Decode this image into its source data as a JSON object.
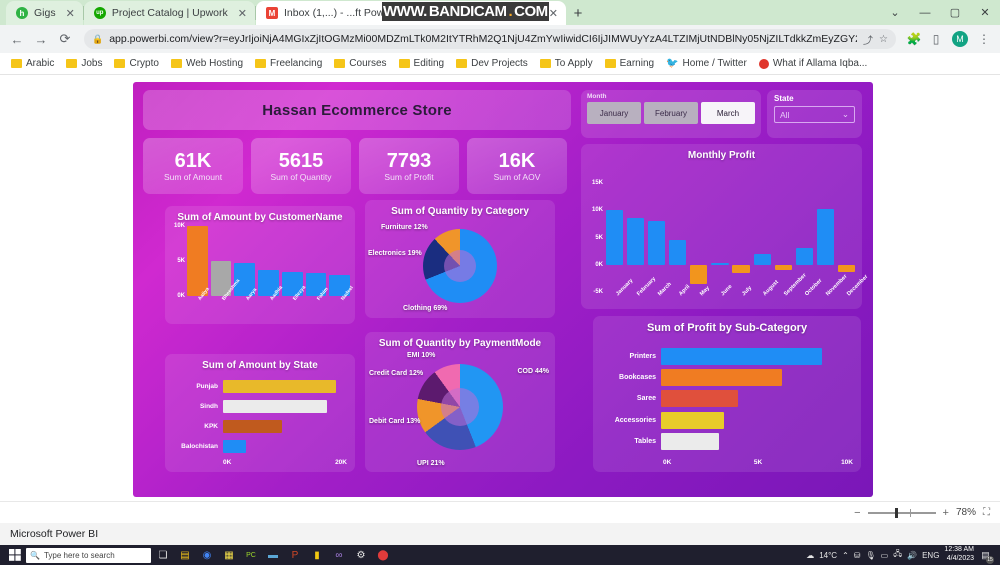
{
  "browser": {
    "tabs": [
      {
        "title": "Gigs",
        "favicon_letter": "h",
        "favicon_color": "#2fb344",
        "active": false
      },
      {
        "title": "Project Catalog | Upwork",
        "favicon_letter": "up",
        "favicon_color": "#14a800",
        "active": false
      },
      {
        "title": "Inbox (1,...) - ...ft Power BI",
        "favicon_letter": "M",
        "favicon_color": "#ea4335",
        "active": true
      }
    ],
    "newtab_label": "+",
    "window_controls": {
      "list": "⌄",
      "minimize": "—",
      "maximize": "▢",
      "close": "✕"
    },
    "nav": {
      "back": "←",
      "forward": "→",
      "reload": "⟳"
    },
    "omnibox": {
      "lock_icon": "lock-icon",
      "url": "app.powerbi.com/view?r=eyJrIjoiNjA4MGIxZjItOGMzMi00MDZmLTk0M2ItYTRhM2Q1NjU4ZmYwIiwidCI6IjJIMWUyYzA4LTZIMjUtNDBlNy05NjZILTdkkZmEyZGY2Y...",
      "share_icon": "share-icon",
      "star_icon": "bookmark-star-icon"
    },
    "toolbar_icons": {
      "extensions": "puzzle-icon",
      "sidepanel": "side-panel-icon",
      "profile": "M",
      "menu": "⋮"
    },
    "bookmarks": [
      {
        "label": "Arabic",
        "type": "folder"
      },
      {
        "label": "Jobs",
        "type": "folder"
      },
      {
        "label": "Crypto",
        "type": "folder"
      },
      {
        "label": "Web Hosting",
        "type": "folder"
      },
      {
        "label": "Freelancing",
        "type": "folder"
      },
      {
        "label": "Courses",
        "type": "folder"
      },
      {
        "label": "Editing",
        "type": "folder"
      },
      {
        "label": "Dev Projects",
        "type": "folder"
      },
      {
        "label": "To Apply",
        "type": "folder"
      },
      {
        "label": "Earning",
        "type": "folder"
      },
      {
        "label": "Home / Twitter",
        "type": "twitter"
      },
      {
        "label": "What if Allama Iqba...",
        "type": "site"
      }
    ]
  },
  "watermark": {
    "text_pre": "WWW.",
    "text_mid": "BANDICAM",
    "text_dot": ".",
    "text_post": "COM"
  },
  "report": {
    "header_title": "Hassan Ecommerce Store",
    "kpis": [
      {
        "value": "61K",
        "label": "Sum of Amount"
      },
      {
        "value": "5615",
        "label": "Sum of Quantity"
      },
      {
        "value": "7793",
        "label": "Sum of Profit"
      },
      {
        "value": "16K",
        "label": "Sum of AOV"
      }
    ],
    "month_slicer": {
      "label": "Month",
      "options": [
        "January",
        "February",
        "March"
      ],
      "selected": "March"
    },
    "state_filter": {
      "label": "State",
      "value": "All",
      "chevron": "chevron-down-icon"
    }
  },
  "zoom_bar": {
    "minus": "−",
    "plus": "+",
    "percent": "78%",
    "fit_icon": "fit-to-page-icon"
  },
  "status_strip": {
    "title": "Microsoft Power BI"
  },
  "taskbar": {
    "start_icon": "windows-start-icon",
    "search_placeholder": "Type here to search",
    "search_icon": "search-icon",
    "items": [
      {
        "name": "task-view-icon",
        "glyph": "❏"
      },
      {
        "name": "file-explorer-icon",
        "glyph": "▤"
      },
      {
        "name": "chrome-icon",
        "glyph": "◉"
      },
      {
        "name": "sticky-notes-icon",
        "glyph": "▦"
      },
      {
        "name": "pycharm-icon",
        "glyph": "PC"
      },
      {
        "name": "mysql-workbench-icon",
        "glyph": "▬"
      },
      {
        "name": "powerpoint-icon",
        "glyph": "P"
      },
      {
        "name": "power-bi-icon",
        "glyph": "▮"
      },
      {
        "name": "visual-studio-icon",
        "glyph": "∞"
      },
      {
        "name": "settings-icon",
        "glyph": "⚙"
      },
      {
        "name": "bandicam-record-icon",
        "glyph": "⬤"
      }
    ],
    "weather": {
      "icon": "cloud-icon",
      "temp": "14°C"
    },
    "tray": {
      "chevron": "⌃",
      "onedrive": "☁",
      "mic": "🎙",
      "battery": "▭",
      "network": "🖧",
      "volume": "🔊"
    },
    "language": "ENG",
    "clock": {
      "time": "12:38 AM",
      "date": "4/4/2023"
    },
    "notifications": {
      "icon": "notifications-icon",
      "count": "15"
    }
  },
  "chart_data": [
    {
      "type": "bar",
      "id": "monthly-profit",
      "title": "Monthly Profit",
      "categories": [
        "January",
        "February",
        "March",
        "April",
        "May",
        "June",
        "July",
        "August",
        "September",
        "October",
        "November",
        "December"
      ],
      "values": [
        10000,
        8600,
        8000,
        4500,
        -3500,
        300,
        -1500,
        2000,
        -1000,
        3000,
        10300,
        -1300
      ],
      "ylim": [
        -5000,
        15000
      ],
      "ytick_labels": [
        "15K",
        "10K",
        "5K",
        "0K",
        "-5K"
      ],
      "ytick_values": [
        15000,
        10000,
        5000,
        0,
        -5000
      ],
      "positive_color": "#1f8df5",
      "negative_color": "#f2951d",
      "xlabel": "",
      "ylabel": "",
      "grid": false,
      "legend": false
    },
    {
      "type": "bar",
      "id": "amount-by-customer",
      "title": "Sum of Amount by CustomerName",
      "categories": [
        "Aaliya",
        "Bheeshma",
        "Aarya",
        "Aadhia",
        "Ellezya",
        "Fahim",
        "Nadeel"
      ],
      "values": [
        10000,
        5000,
        4700,
        3700,
        3400,
        3300,
        3000
      ],
      "ylim": [
        0,
        10000
      ],
      "ytick_labels": [
        "10K",
        "5K",
        "0K"
      ],
      "ytick_values": [
        10000,
        5000,
        0
      ],
      "colors": [
        "#f07c22",
        "#a8a8a8",
        "#1f8df5",
        "#1f8df5",
        "#1f8df5",
        "#1f8df5",
        "#1f8df5"
      ],
      "xlabel": "",
      "ylabel": "",
      "grid": false,
      "legend": false
    },
    {
      "type": "bar",
      "id": "amount-by-state",
      "orientation": "horizontal",
      "title": "Sum of Amount by State",
      "categories": [
        "Punjab",
        "Sindh",
        "KPK",
        "Balochistan"
      ],
      "values": [
        20000,
        18500,
        10500,
        4000
      ],
      "xlim": [
        0,
        22000
      ],
      "xtick_labels": [
        "0K",
        "20K"
      ],
      "xtick_values": [
        0,
        20000
      ],
      "colors": [
        "#e8b92a",
        "#ebebeb",
        "#c05a1e",
        "#1f8df5"
      ],
      "xlabel": "",
      "ylabel": "",
      "grid": false,
      "legend": false
    },
    {
      "type": "bar",
      "id": "profit-by-subcategory",
      "orientation": "horizontal",
      "title": "Sum of Profit by Sub-Category",
      "categories": [
        "Printers",
        "Bookcases",
        "Saree",
        "Accessories",
        "Tables"
      ],
      "values": [
        8400,
        6300,
        4000,
        3300,
        3000
      ],
      "xlim": [
        0,
        10000
      ],
      "xtick_labels": [
        "0K",
        "5K",
        "10K"
      ],
      "xtick_values": [
        0,
        5000,
        10000
      ],
      "colors": [
        "#1f8df5",
        "#f07c22",
        "#e0503c",
        "#e8cc2a",
        "#ebebeb"
      ],
      "xlabel": "",
      "ylabel": "",
      "grid": false,
      "legend": false
    },
    {
      "type": "pie",
      "id": "quantity-by-category",
      "title": "Sum of Quantity by Category",
      "labels": [
        "Clothing",
        "Electronics",
        "Furniture"
      ],
      "values": [
        69,
        19,
        12
      ],
      "label_texts": [
        "Clothing 69%",
        "Electronics 19%",
        "Furniture 12%"
      ],
      "colors": [
        "#1f8df5",
        "#1a2d80",
        "#f0952a"
      ],
      "donut": true
    },
    {
      "type": "pie",
      "id": "quantity-by-paymentmode",
      "title": "Sum of Quantity by PaymentMode",
      "labels": [
        "COD",
        "UPI",
        "Debit Card",
        "Credit Card",
        "EMI"
      ],
      "values": [
        44,
        21,
        13,
        12,
        10
      ],
      "label_texts": [
        "COD 44%",
        "UPI 21%",
        "Debit Card 13%",
        "Credit Card 12%",
        "EMI 10%"
      ],
      "colors": [
        "#2196f3",
        "#3f51b5",
        "#f0952a",
        "#5c1a6e",
        "#f06ab0"
      ],
      "donut": true
    }
  ]
}
